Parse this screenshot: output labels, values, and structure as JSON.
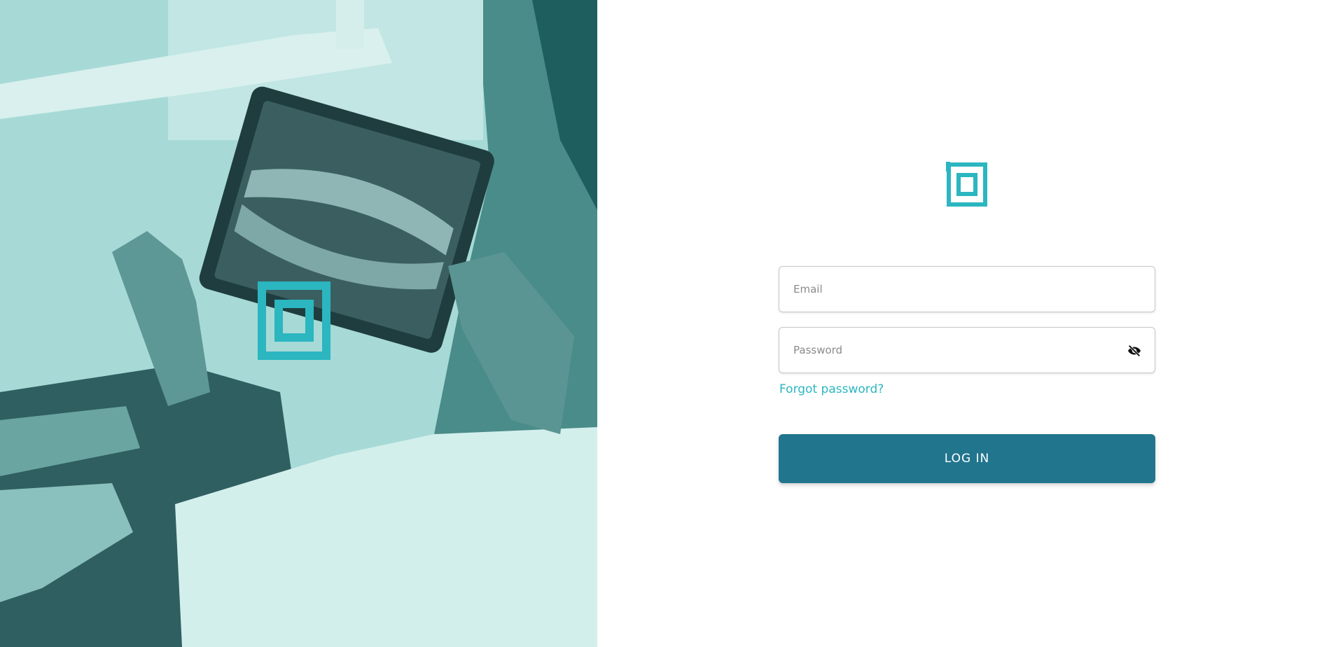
{
  "hero": {
    "image_icon": "dental-xray-tablet-photo",
    "overlay_color": "#9fd3d0",
    "logo_icon": "brand-logo-icon",
    "logo_color": "#2bb6c0"
  },
  "login": {
    "logo_icon": "brand-logo-icon",
    "logo_color": "#2bb6c0",
    "email": {
      "placeholder": "Email",
      "value": ""
    },
    "password": {
      "placeholder": "Password",
      "value": "",
      "toggle_icon": "eye-off-icon"
    },
    "forgot_password_label": "Forgot password?",
    "login_button_label": "LOG IN",
    "accent_color": "#2bb6c0",
    "button_color": "#21758d"
  }
}
